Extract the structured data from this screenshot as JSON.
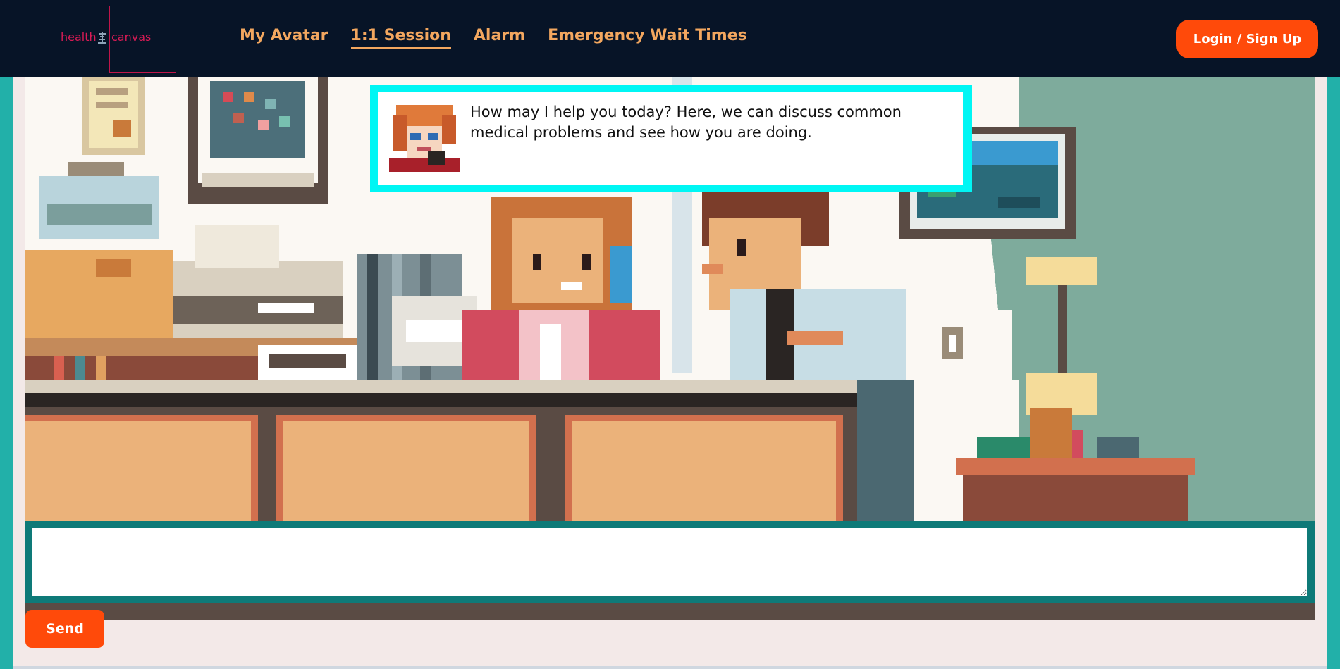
{
  "brand": {
    "logo_left": "health",
    "logo_right": "canvas"
  },
  "nav": {
    "links": [
      {
        "label": "My Avatar"
      },
      {
        "label": "1:1 Session"
      },
      {
        "label": "Alarm"
      },
      {
        "label": "Emergency Wait Times"
      }
    ],
    "active_index": 1,
    "login_label": "Login / Sign Up"
  },
  "dialog": {
    "message": "How may I help you today? Here, we can discuss common medical problems and see how you are doing."
  },
  "chat": {
    "input_value": "",
    "send_label": "Send"
  },
  "colors": {
    "nav_bg": "#071427",
    "accent_orange": "#ff4a0a",
    "nav_link": "#f3a75f",
    "teal": "#22b0a9",
    "dialog_border": "#00f6f4"
  },
  "icons": [
    "caduceus-logo-icon",
    "doctor-portrait-icon"
  ]
}
